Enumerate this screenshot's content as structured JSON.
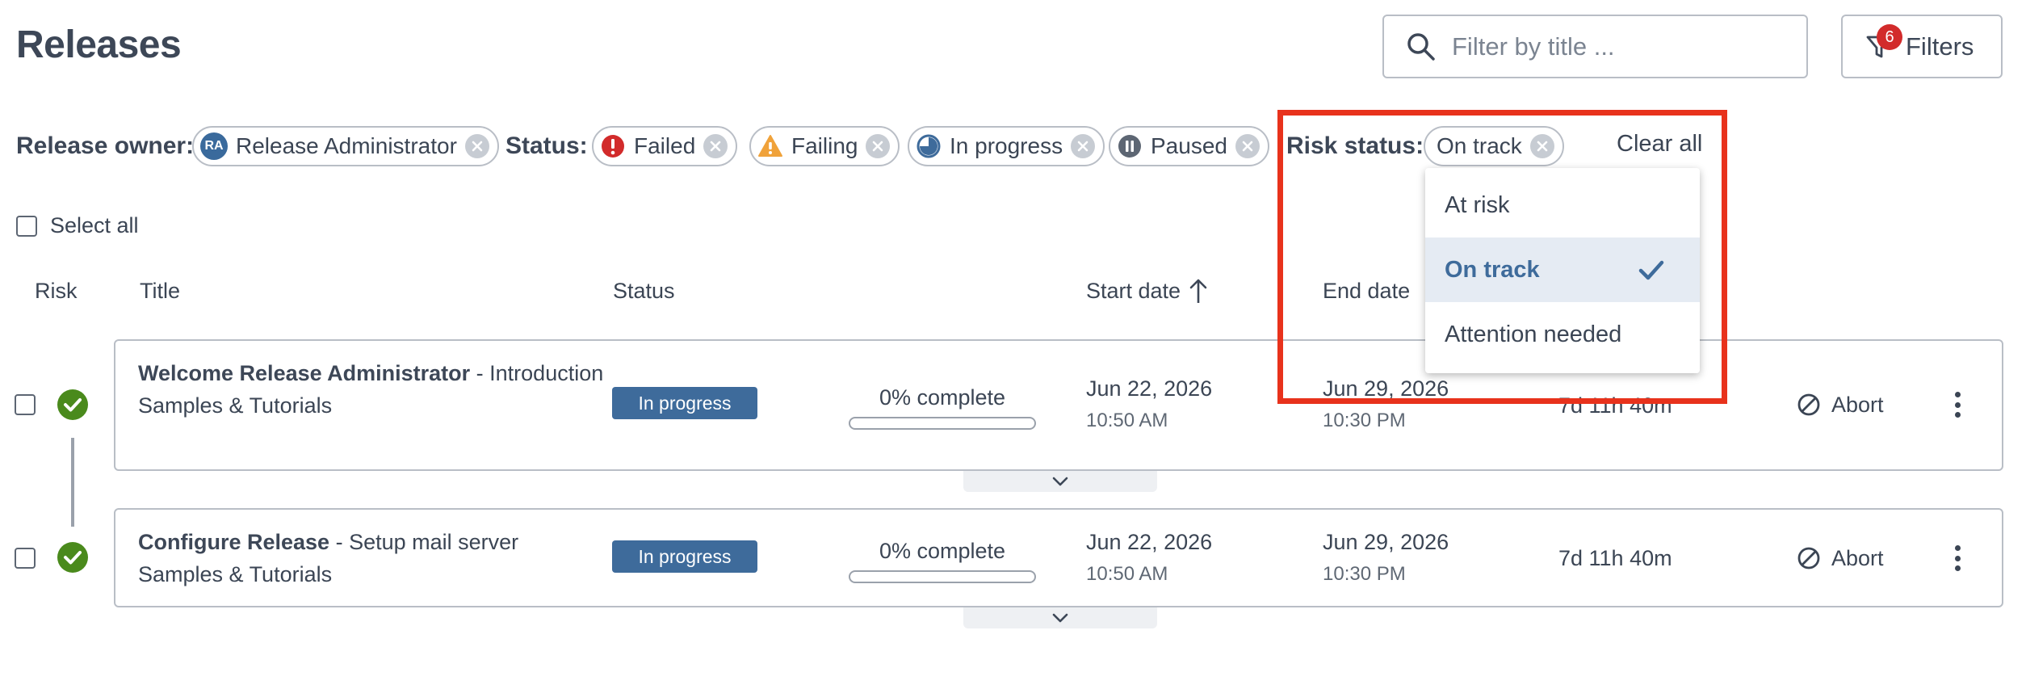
{
  "page": {
    "title": "Releases"
  },
  "search": {
    "placeholder": "Filter by title ..."
  },
  "filters_button": {
    "label": "Filters",
    "badge": "6"
  },
  "filter_bar": {
    "owner_label": "Release owner:",
    "owner_chip": {
      "initials": "RA",
      "label": "Release Administrator"
    },
    "status_label": "Status:",
    "status_chips": [
      {
        "label": "Failed",
        "icon": "error-icon"
      },
      {
        "label": "Failing",
        "icon": "warning-icon"
      },
      {
        "label": "In progress",
        "icon": "in-progress-icon"
      },
      {
        "label": "Paused",
        "icon": "pause-icon"
      }
    ],
    "risk_label": "Risk status:",
    "risk_chip": {
      "label": "On track"
    },
    "clear_all": "Clear all"
  },
  "select_all": {
    "label": "Select all"
  },
  "columns": {
    "risk": "Risk",
    "title": "Title",
    "status": "Status",
    "start_date": "Start date",
    "end_date": "End date"
  },
  "releases": [
    {
      "title_bold": "Welcome Release Administrator",
      "title_rest": " - Introduction",
      "folder": "Samples & Tutorials",
      "status": "In progress",
      "progress_text": "0% complete",
      "progress": 0,
      "start_date": "Jun 22, 2026",
      "start_time": "10:50 AM",
      "end_date": "Jun 29, 2026",
      "end_time": "10:30 PM",
      "duration": "7d 11h 40m",
      "action": "Abort",
      "risk": "on-track"
    },
    {
      "title_bold": "Configure Release",
      "title_rest": " - Setup mail server",
      "folder": "Samples & Tutorials",
      "status": "In progress",
      "progress_text": "0% complete",
      "progress": 0,
      "start_date": "Jun 22, 2026",
      "start_time": "10:50 AM",
      "end_date": "Jun 29, 2026",
      "end_time": "10:30 PM",
      "duration": "7d 11h 40m",
      "action": "Abort",
      "risk": "on-track"
    }
  ],
  "risk_dropdown": {
    "options": [
      "At risk",
      "On track",
      "Attention needed"
    ],
    "selected": "On track"
  },
  "colors": {
    "accent": "#3e6b9b",
    "success": "#4a8a1c",
    "error": "#d22b2b",
    "warning": "#f0a23a",
    "highlight": "#e8321c"
  }
}
